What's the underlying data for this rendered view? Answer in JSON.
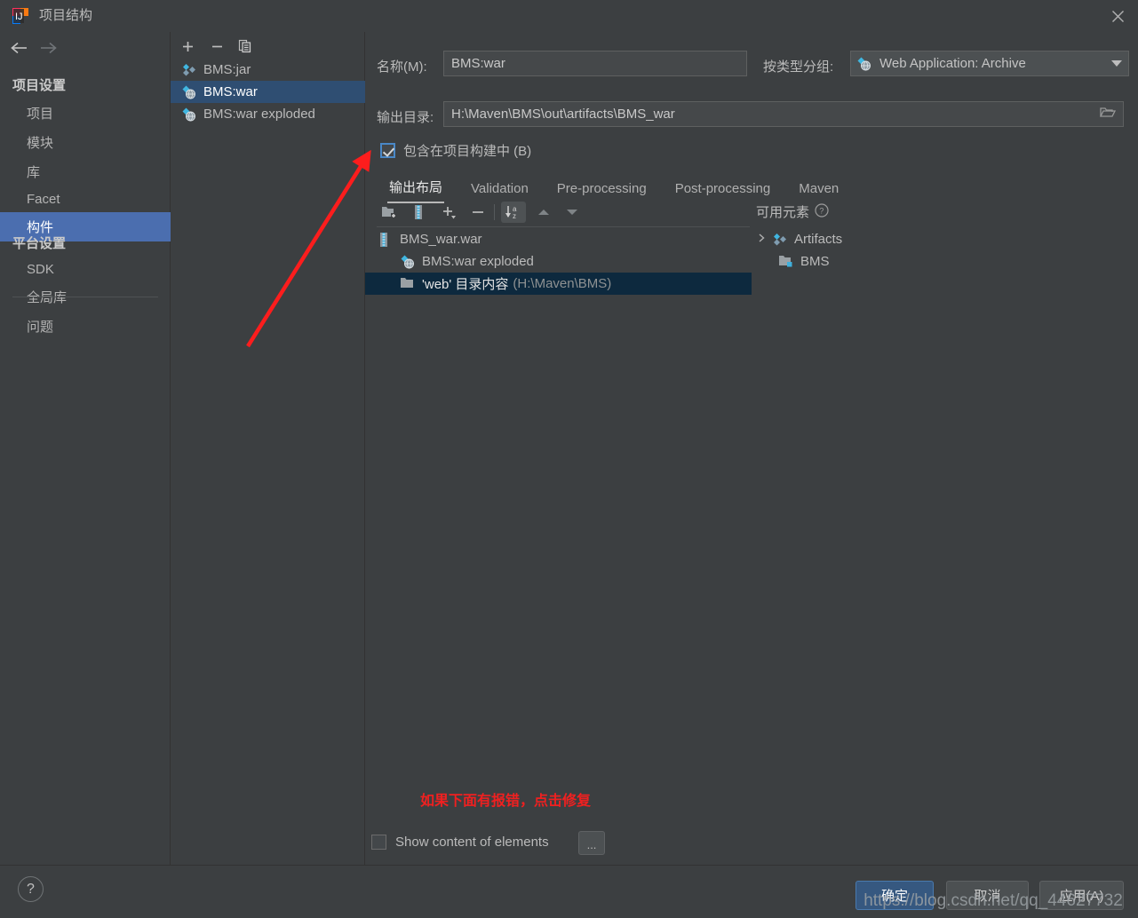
{
  "window": {
    "title": "项目结构",
    "logo_icon": "intellij-idea-logo",
    "close_icon": "close-icon"
  },
  "sidebar": {
    "back_icon": "arrow-left-icon",
    "forward_icon": "arrow-right-icon",
    "groups": [
      {
        "title": "项目设置",
        "items": [
          {
            "label": "项目",
            "selected": false
          },
          {
            "label": "模块",
            "selected": false
          },
          {
            "label": "库",
            "selected": false
          },
          {
            "label": "Facet",
            "selected": false
          },
          {
            "label": "构件",
            "selected": true
          }
        ]
      },
      {
        "title": "平台设置",
        "items": [
          {
            "label": "SDK",
            "selected": false
          },
          {
            "label": "全局库",
            "selected": false
          }
        ]
      }
    ],
    "problems": {
      "label": "问题",
      "selected": false
    }
  },
  "artifacts_panel": {
    "toolbar": [
      {
        "name": "add-artifact-button",
        "icon": "plus-icon"
      },
      {
        "name": "remove-artifact-button",
        "icon": "minus-icon"
      },
      {
        "name": "copy-artifact-button",
        "icon": "copy-icon"
      }
    ],
    "items": [
      {
        "label": "BMS:jar",
        "icon": "artifact-jar-icon",
        "selected": false
      },
      {
        "label": "BMS:war",
        "icon": "artifact-war-icon",
        "selected": true
      },
      {
        "label": "BMS:war exploded",
        "icon": "artifact-war-exploded-icon",
        "selected": false
      }
    ]
  },
  "editor": {
    "name_label": "名称(M):",
    "name_value": "BMS:war",
    "group_label": "按类型分组:",
    "group_value": "Web Application: Archive",
    "group_icon": "artifact-war-icon",
    "output_label": "输出目录:",
    "output_value": "H:\\Maven\\BMS\\out\\artifacts\\BMS_war",
    "browse_icon": "folder-open-icon",
    "include_in_build": {
      "label": "包含在项目构建中 (B)",
      "checked": true
    },
    "tabs": [
      {
        "label": "输出布局",
        "active": true
      },
      {
        "label": "Validation",
        "active": false
      },
      {
        "label": "Pre-processing",
        "active": false
      },
      {
        "label": "Post-processing",
        "active": false
      },
      {
        "label": "Maven",
        "active": false
      }
    ],
    "layout_toolbar": [
      {
        "name": "add-directory-button",
        "icon": "folder-add-icon",
        "boxed": false
      },
      {
        "name": "add-archive-button",
        "icon": "archive-icon",
        "boxed": false
      },
      {
        "name": "add-element-button",
        "icon": "plus-dropdown-icon",
        "boxed": false
      },
      {
        "name": "remove-element-button",
        "icon": "minus-icon",
        "boxed": false
      },
      {
        "name": "sort-alphabetically-button",
        "icon": "sort-az-icon",
        "boxed": true
      },
      {
        "name": "move-up-button",
        "icon": "triangle-up-icon",
        "boxed": false
      },
      {
        "name": "move-down-button",
        "icon": "triangle-down-icon",
        "boxed": false
      }
    ],
    "layout_tree": [
      {
        "label": "BMS_war.war",
        "detail": "",
        "icon": "archive-icon",
        "indent": 0,
        "selected": false
      },
      {
        "label": "BMS:war exploded",
        "detail": "",
        "icon": "artifact-war-exploded-icon",
        "indent": 1,
        "selected": false
      },
      {
        "label": "'web' 目录内容",
        "detail": "(H:\\Maven\\BMS)",
        "icon": "folder-icon",
        "indent": 1,
        "selected": true
      }
    ],
    "available_elements": {
      "title": "可用元素",
      "help_icon": "help-circle-icon",
      "items": [
        {
          "label": "Artifacts",
          "icon": "artifact-jar-icon",
          "expandable": true,
          "indent": 0
        },
        {
          "label": "BMS",
          "icon": "module-icon",
          "expandable": false,
          "indent": 1
        }
      ]
    },
    "show_content": {
      "label": "Show content of elements",
      "checked": false,
      "more_button": "..."
    }
  },
  "annotations": {
    "red_note": "如果下面有报错，点击修复",
    "arrow_color": "#fc1d1d",
    "arrow_name": "red-pointer-arrow"
  },
  "footer": {
    "help_icon": "question-mark-icon",
    "buttons": [
      {
        "label": "确定",
        "primary": true
      },
      {
        "label": "取消",
        "primary": false
      },
      {
        "label": "应用(A)",
        "primary": false
      }
    ]
  },
  "watermark": {
    "text": "https://blog.csdn.net/qq_44627732"
  }
}
